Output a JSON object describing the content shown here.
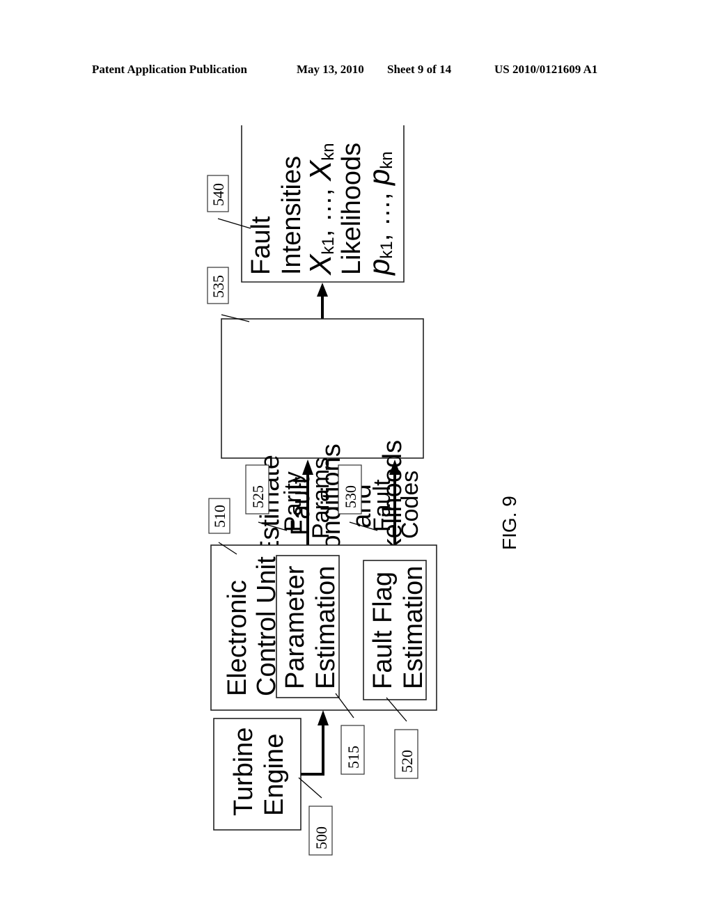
{
  "header": {
    "publication": "Patent Application Publication",
    "date": "May 13, 2010",
    "sheet": "Sheet 9 of 14",
    "patent_number": "US 2010/0121609 A1"
  },
  "figure_label": "FIG. 9",
  "blocks": {
    "turbine_engine": {
      "lines": [
        "Turbine",
        "Engine"
      ],
      "ref": "500"
    },
    "ecu": {
      "lines": [
        "Electronic",
        "Control Unit"
      ],
      "ref": "510"
    },
    "parameter_estimation": {
      "lines": [
        "Parameter",
        "Estimation"
      ],
      "ref": "515"
    },
    "fault_flag_estimation": {
      "lines": [
        "Fault Flag",
        "Estimation"
      ],
      "ref": "520"
    },
    "estimate": {
      "lines": [
        "Estimate",
        "Fault",
        "Conditions",
        "and",
        "Likelihoods"
      ],
      "ref": "535"
    },
    "output": {
      "lines": [
        "Fault",
        "Intensities"
      ],
      "x_line": {
        "base1": "X",
        "sub1": "k1",
        "mid": ", …, ",
        "base2": "X",
        "sub2": "kn"
      },
      "likelihoods": "Likelihoods",
      "p_line": {
        "base1": "p",
        "sub1": "k1",
        "mid": ", …, ",
        "base2": "p",
        "sub2": "kn"
      },
      "ref": "540"
    }
  },
  "signals": {
    "parity_params": {
      "lines": [
        "Parity",
        "Params"
      ],
      "ref": "525"
    },
    "fault_codes": {
      "lines": [
        "Fault",
        "Codes"
      ],
      "ref": "530"
    }
  }
}
